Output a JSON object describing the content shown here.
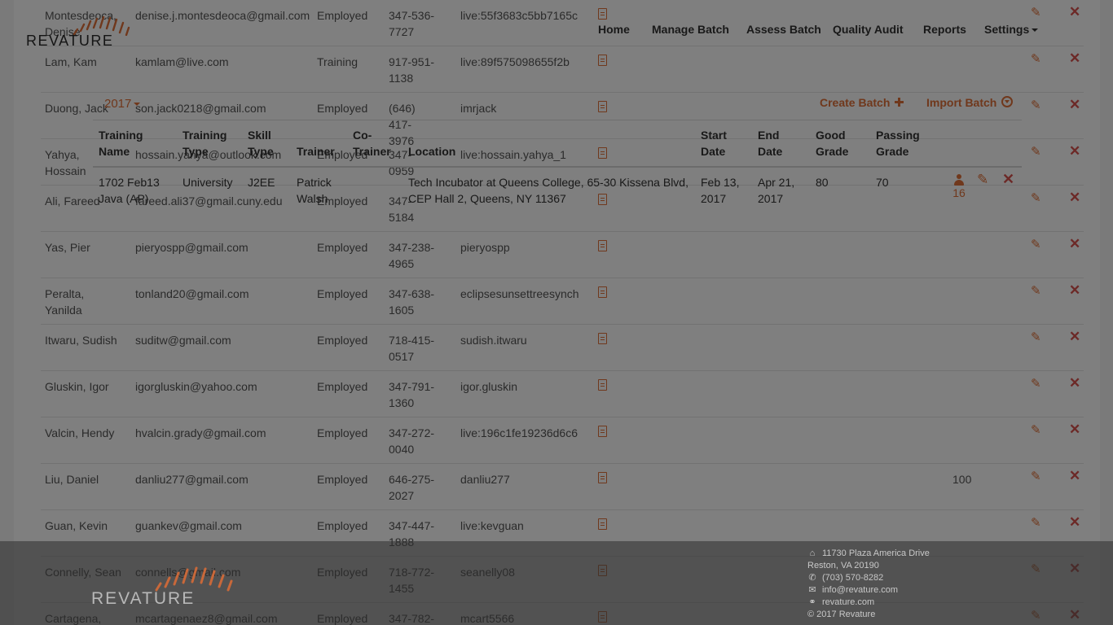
{
  "brand": {
    "logo_text": "REVATURE",
    "accent_color": "#e07038"
  },
  "nav": {
    "items": [
      "Home",
      "Manage Batch",
      "Assess Batch",
      "Quality Audit",
      "Reports",
      "Settings"
    ]
  },
  "toolbar": {
    "year": "2017",
    "create_batch": "Create Batch",
    "import_batch": "Import Batch",
    "create_icon": "plus-icon",
    "import_icon": "download-circle-icon"
  },
  "batch_table": {
    "headers": {
      "training_name": [
        "Training",
        "Name"
      ],
      "training_type": [
        "Training",
        "Type"
      ],
      "skill_type": [
        "Skill",
        "Type"
      ],
      "trainer": "Trainer",
      "co_trainer": [
        "Co-",
        "Trainer"
      ],
      "location": "Location",
      "start_date": [
        "Start",
        "Date"
      ],
      "end_date": [
        "End",
        "Date"
      ],
      "good_grade": [
        "Good",
        "Grade"
      ],
      "passing_grade": [
        "Passing",
        "Grade"
      ]
    },
    "rows": [
      {
        "training_name": [
          "1702 Feb13",
          "Java (AP)"
        ],
        "training_type": "University",
        "skill_type": "J2EE",
        "trainer": [
          "Patrick",
          "Walsh"
        ],
        "co_trainer": "",
        "location": [
          "Tech Incubator at Queens College, 65-30 Kissena Blvd,",
          "CEP Hall 2, Queens, NY 11367"
        ],
        "start_date": [
          "Feb 13,",
          "2017"
        ],
        "end_date": [
          "Apr 21,",
          "2017"
        ],
        "good_grade": "80",
        "passing_grade": "70",
        "trainee_count": "16"
      }
    ]
  },
  "trainees": [
    {
      "name": [
        "Montesdeoca,",
        "Denise"
      ],
      "email": "denise.j.montesdeoca@gmail.com",
      "status": "Employed",
      "phone": [
        "347-536-",
        "7727"
      ],
      "skype": "live:55f3683c5bb7165c",
      "score": ""
    },
    {
      "name": [
        "Lam, Kam"
      ],
      "email": "kamlam@live.com",
      "status": "Training",
      "phone": [
        "917-951-",
        "1138"
      ],
      "skype": "live:89f575098655f2b",
      "score": ""
    },
    {
      "name": [
        "Duong, Jack"
      ],
      "email": "son.jack0218@gmail.com",
      "status": "Employed",
      "phone": [
        "(646) 417-",
        "3976"
      ],
      "skype": "imrjack",
      "score": ""
    },
    {
      "name": [
        "Yahya,",
        "Hossain"
      ],
      "email": "hossain.yahya@outlook.com",
      "status": "Employed",
      "phone": [
        "347-",
        "0959"
      ],
      "skype": "live:hossain.yahya_1",
      "score": ""
    },
    {
      "name": [
        "Ali, Fareed"
      ],
      "email": "fareed.ali37@gmail.cuny.edu",
      "status": "Employed",
      "phone": [
        "347-",
        "5184"
      ],
      "skype": "",
      "score": ""
    },
    {
      "name": [
        "Yas, Pier"
      ],
      "email": "pieryospp@gmail.com",
      "status": "Employed",
      "phone": [
        "347-238-",
        "4965"
      ],
      "skype": "pieryospp",
      "score": ""
    },
    {
      "name": [
        "Peralta,",
        "Yanilda"
      ],
      "email": "tonland20@gmail.com",
      "status": "Employed",
      "phone": [
        "347-638-",
        "1605"
      ],
      "skype": "eclipsesunsettreesynch",
      "score": ""
    },
    {
      "name": [
        "Itwaru, Sudish"
      ],
      "email": "suditw@gmail.com",
      "status": "Employed",
      "phone": [
        "718-415-",
        "0517"
      ],
      "skype": "sudish.itwaru",
      "score": ""
    },
    {
      "name": [
        "Gluskin, Igor"
      ],
      "email": "igorgluskin@yahoo.com",
      "status": "Employed",
      "phone": [
        "347-791-",
        "1360"
      ],
      "skype": "igor.gluskin",
      "score": ""
    },
    {
      "name": [
        "Valcin, Hendy"
      ],
      "email": "hvalcin.grady@gmail.com",
      "status": "Employed",
      "phone": [
        "347-272-",
        "0040"
      ],
      "skype": "live:196c1fe19236d6c6",
      "score": ""
    },
    {
      "name": [
        "Liu, Daniel"
      ],
      "email": "danliu277@gmail.com",
      "status": "Employed",
      "phone": [
        "646-275-",
        "2027"
      ],
      "skype": "danliu277",
      "score": "100"
    },
    {
      "name": [
        "Guan, Kevin"
      ],
      "email": "guankev@gmail.com",
      "status": "Employed",
      "phone": [
        "347-447-",
        "1888"
      ],
      "skype": "live:kevguan",
      "score": ""
    },
    {
      "name": [
        "Connelly, Sean"
      ],
      "email": "connells@gmail.com",
      "status": "Employed",
      "phone": [
        "718-772-",
        "1455"
      ],
      "skype": "seanelly08",
      "score": ""
    },
    {
      "name": [
        "Cartagena,"
      ],
      "email": "mcartagenaez8@gmail.com",
      "status": "Employed",
      "phone": [
        "347-782-"
      ],
      "skype": "mcart5566",
      "score": ""
    }
  ],
  "footer": {
    "address_line1": "11730 Plaza America Drive",
    "address_line2": "Reston, VA 20190",
    "phone": "(703) 570-8282",
    "email": "info@revature.com",
    "website": "revature.com",
    "copyright": "© 2017 Revature"
  }
}
